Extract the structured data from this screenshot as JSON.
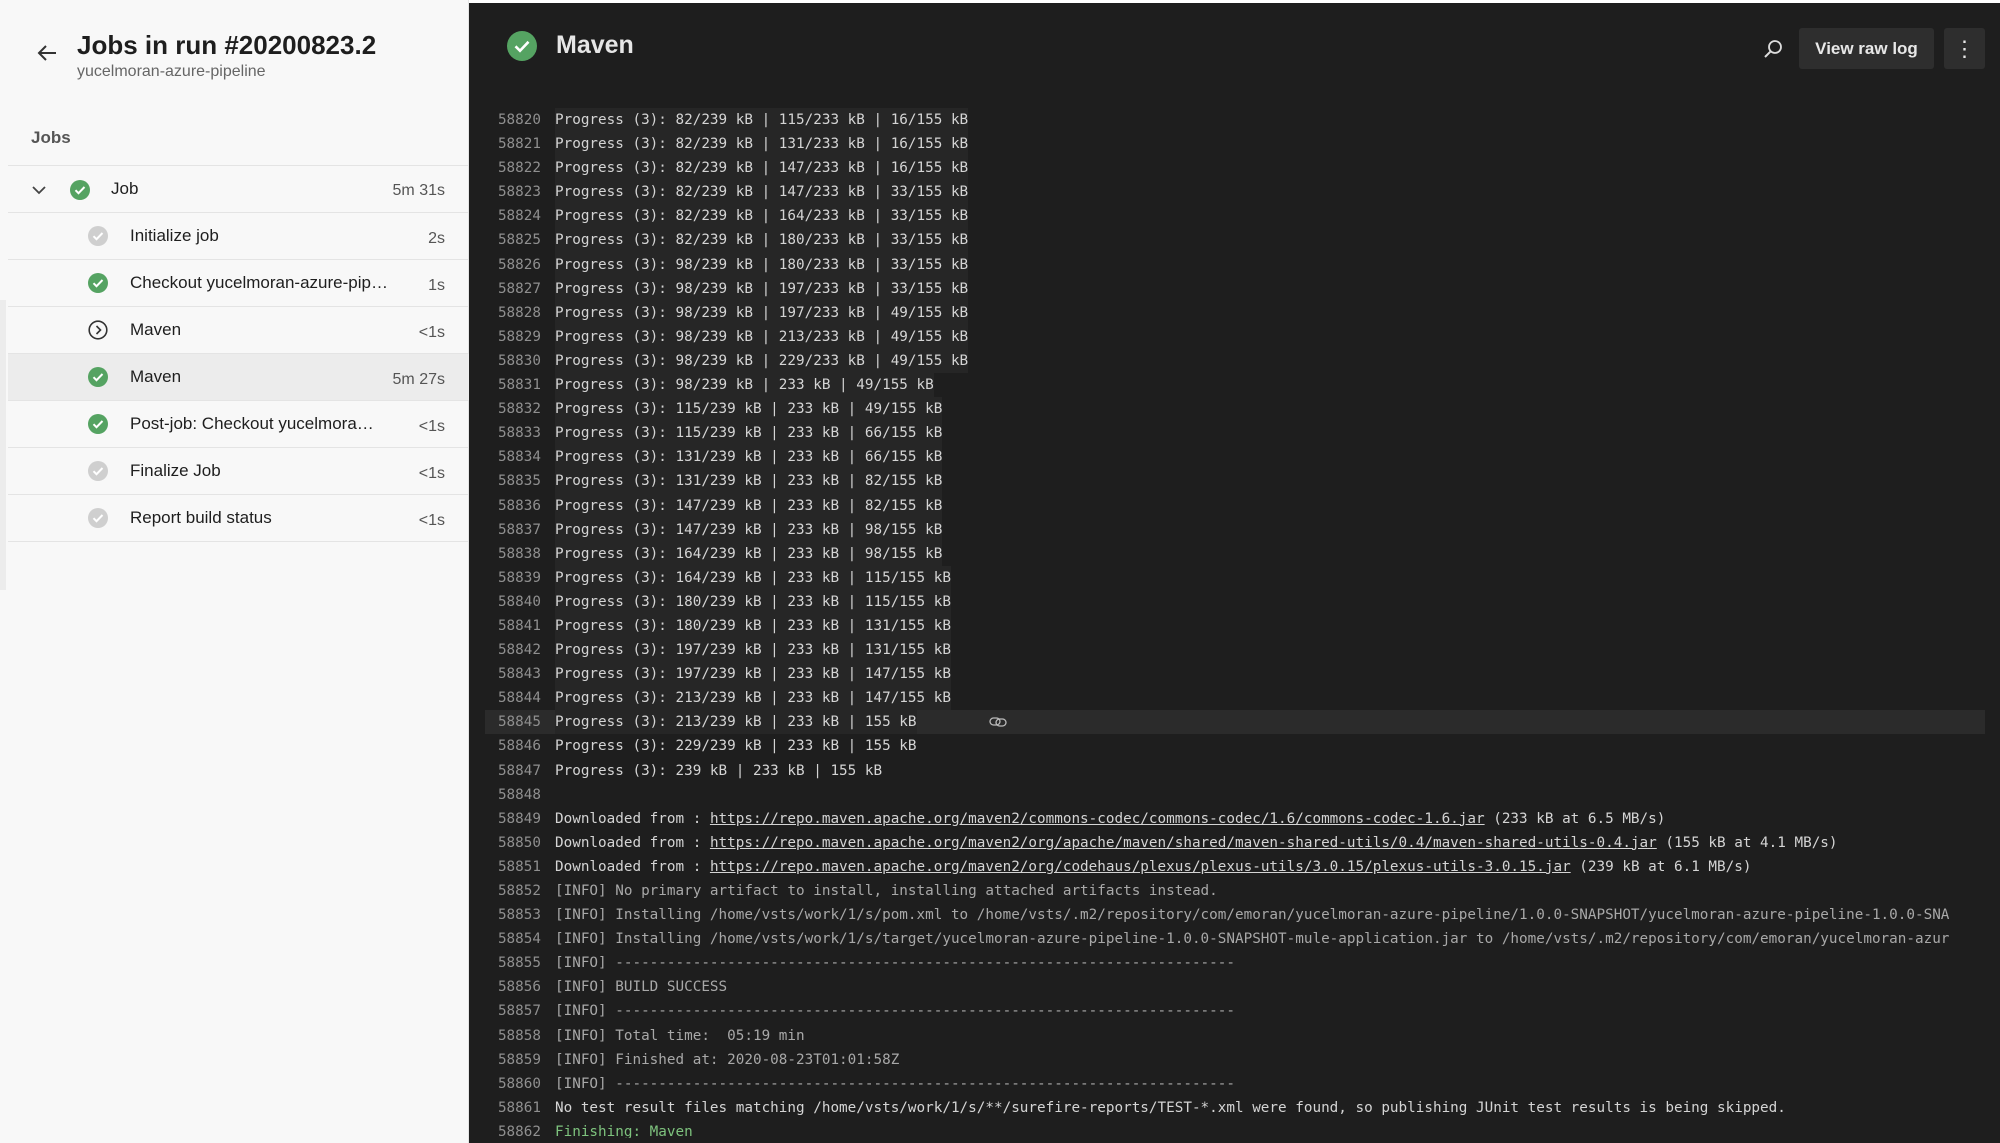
{
  "sidebar": {
    "title": "Jobs in run #20200823.2",
    "subtitle": "yucelmoran-azure-pipeline",
    "section_label": "Jobs",
    "job": {
      "label": "Job",
      "duration": "5m 31s",
      "status": "success"
    },
    "steps": [
      {
        "label": "Initialize job",
        "duration": "2s",
        "status": "done"
      },
      {
        "label": "Checkout yucelmoran-azure-pip…",
        "duration": "1s",
        "status": "success"
      },
      {
        "label": "Maven",
        "duration": "<1s",
        "status": "skipped"
      },
      {
        "label": "Maven",
        "duration": "5m 27s",
        "status": "success",
        "selected": true
      },
      {
        "label": "Post-job: Checkout yucelmora…",
        "duration": "<1s",
        "status": "success"
      },
      {
        "label": "Finalize Job",
        "duration": "<1s",
        "status": "done"
      },
      {
        "label": "Report build status",
        "duration": "<1s",
        "status": "done"
      }
    ]
  },
  "main": {
    "title": "Maven",
    "view_raw_label": "View raw log",
    "more_label": "⋮"
  },
  "colors": {
    "success": "#55a362",
    "done": "#cfcfcf",
    "log_bg": "#1e1e1e"
  },
  "icons": [
    "back-arrow-icon",
    "chevron-down-icon",
    "success-check-icon",
    "skipped-icon",
    "search-icon",
    "more-icon",
    "link-icon"
  ],
  "log": [
    {
      "n": "58820",
      "t": "Progress (3): 82/239 kB | 115/233 kB | 16/155 kB",
      "k": "progress"
    },
    {
      "n": "58821",
      "t": "Progress (3): 82/239 kB | 131/233 kB | 16/155 kB",
      "k": "progress"
    },
    {
      "n": "58822",
      "t": "Progress (3): 82/239 kB | 147/233 kB | 16/155 kB",
      "k": "progress"
    },
    {
      "n": "58823",
      "t": "Progress (3): 82/239 kB | 147/233 kB | 33/155 kB",
      "k": "progress"
    },
    {
      "n": "58824",
      "t": "Progress (3): 82/239 kB | 164/233 kB | 33/155 kB",
      "k": "progress"
    },
    {
      "n": "58825",
      "t": "Progress (3): 82/239 kB | 180/233 kB | 33/155 kB",
      "k": "progress"
    },
    {
      "n": "58826",
      "t": "Progress (3): 98/239 kB | 180/233 kB | 33/155 kB",
      "k": "progress"
    },
    {
      "n": "58827",
      "t": "Progress (3): 98/239 kB | 197/233 kB | 33/155 kB",
      "k": "progress"
    },
    {
      "n": "58828",
      "t": "Progress (3): 98/239 kB | 197/233 kB | 49/155 kB",
      "k": "progress"
    },
    {
      "n": "58829",
      "t": "Progress (3): 98/239 kB | 213/233 kB | 49/155 kB",
      "k": "progress"
    },
    {
      "n": "58830",
      "t": "Progress (3): 98/239 kB | 229/233 kB | 49/155 kB",
      "k": "progress"
    },
    {
      "n": "58831",
      "t": "Progress (3): 98/239 kB | 233 kB | 49/155 kB",
      "k": "progress"
    },
    {
      "n": "58832",
      "t": "Progress (3): 115/239 kB | 233 kB | 49/155 kB",
      "k": "progress"
    },
    {
      "n": "58833",
      "t": "Progress (3): 115/239 kB | 233 kB | 66/155 kB",
      "k": "progress"
    },
    {
      "n": "58834",
      "t": "Progress (3): 131/239 kB | 233 kB | 66/155 kB",
      "k": "progress"
    },
    {
      "n": "58835",
      "t": "Progress (3): 131/239 kB | 233 kB | 82/155 kB",
      "k": "progress"
    },
    {
      "n": "58836",
      "t": "Progress (3): 147/239 kB | 233 kB | 82/155 kB",
      "k": "progress"
    },
    {
      "n": "58837",
      "t": "Progress (3): 147/239 kB | 233 kB | 98/155 kB",
      "k": "progress"
    },
    {
      "n": "58838",
      "t": "Progress (3): 164/239 kB | 233 kB | 98/155 kB",
      "k": "progress"
    },
    {
      "n": "58839",
      "t": "Progress (3): 164/239 kB | 233 kB | 115/155 kB",
      "k": "progress"
    },
    {
      "n": "58840",
      "t": "Progress (3): 180/239 kB | 233 kB | 115/155 kB",
      "k": "progress"
    },
    {
      "n": "58841",
      "t": "Progress (3): 180/239 kB | 233 kB | 131/155 kB",
      "k": "progress"
    },
    {
      "n": "58842",
      "t": "Progress (3): 197/239 kB | 233 kB | 131/155 kB",
      "k": "progress"
    },
    {
      "n": "58843",
      "t": "Progress (3): 197/239 kB | 233 kB | 147/155 kB",
      "k": "progress"
    },
    {
      "n": "58844",
      "t": "Progress (3): 213/239 kB | 233 kB | 147/155 kB",
      "k": "progress"
    },
    {
      "n": "58845",
      "t": "Progress (3): 213/239 kB | 233 kB | 155 kB",
      "k": "progress",
      "hl": true
    },
    {
      "n": "58846",
      "t": "Progress (3): 229/239 kB | 233 kB | 155 kB",
      "k": "plain"
    },
    {
      "n": "58847",
      "t": "Progress (3): 239 kB | 233 kB | 155 kB",
      "k": "plain"
    },
    {
      "n": "58848",
      "t": "",
      "k": "plain"
    },
    {
      "n": "58849",
      "pre": "Downloaded from : ",
      "link": "https://repo.maven.apache.org/maven2/commons-codec/commons-codec/1.6/commons-codec-1.6.jar",
      "post": " (233 kB at 6.5 MB/s)",
      "k": "plain"
    },
    {
      "n": "58850",
      "pre": "Downloaded from : ",
      "link": "https://repo.maven.apache.org/maven2/org/apache/maven/shared/maven-shared-utils/0.4/maven-shared-utils-0.4.jar",
      "post": " (155 kB at 4.1 MB/s)",
      "k": "plain"
    },
    {
      "n": "58851",
      "pre": "Downloaded from : ",
      "link": "https://repo.maven.apache.org/maven2/org/codehaus/plexus/plexus-utils/3.0.15/plexus-utils-3.0.15.jar",
      "post": " (239 kB at 6.1 MB/s)",
      "k": "plain"
    },
    {
      "n": "58852",
      "t": "[INFO] No primary artifact to install, installing attached artifacts instead.",
      "k": "info"
    },
    {
      "n": "58853",
      "t": "[INFO] Installing /home/vsts/work/1/s/pom.xml to /home/vsts/.m2/repository/com/emoran/yucelmoran-azure-pipeline/1.0.0-SNAPSHOT/yucelmoran-azure-pipeline-1.0.0-SNA",
      "k": "info"
    },
    {
      "n": "58854",
      "t": "[INFO] Installing /home/vsts/work/1/s/target/yucelmoran-azure-pipeline-1.0.0-SNAPSHOT-mule-application.jar to /home/vsts/.m2/repository/com/emoran/yucelmoran-azur",
      "k": "info"
    },
    {
      "n": "58855",
      "t": "[INFO] ------------------------------------------------------------------------",
      "k": "info"
    },
    {
      "n": "58856",
      "t": "[INFO] BUILD SUCCESS",
      "k": "info"
    },
    {
      "n": "58857",
      "t": "[INFO] ------------------------------------------------------------------------",
      "k": "info"
    },
    {
      "n": "58858",
      "t": "[INFO] Total time:  05:19 min",
      "k": "info"
    },
    {
      "n": "58859",
      "t": "[INFO] Finished at: 2020-08-23T01:01:58Z",
      "k": "info"
    },
    {
      "n": "58860",
      "t": "[INFO] ------------------------------------------------------------------------",
      "k": "info"
    },
    {
      "n": "58861",
      "t": "No test result files matching /home/vsts/work/1/s/**/surefire-reports/TEST-*.xml were found, so publishing JUnit test results is being skipped.",
      "k": "plain"
    },
    {
      "n": "58862",
      "t": "Finishing: Maven",
      "k": "green"
    }
  ]
}
